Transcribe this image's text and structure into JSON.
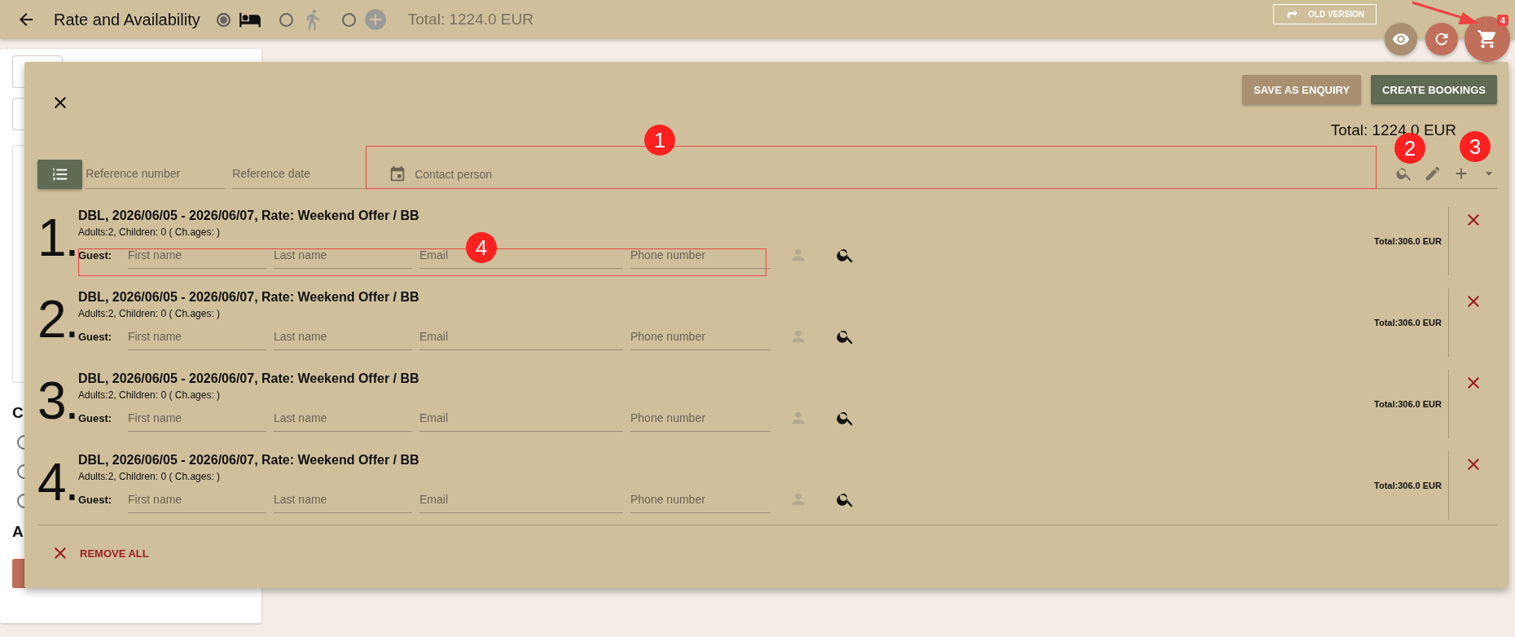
{
  "app_bar": {
    "title": "Rate and Availability",
    "modes": [
      {
        "kind": "room",
        "selected": true
      },
      {
        "kind": "activity",
        "selected": false
      },
      {
        "kind": "extra",
        "selected": false
      }
    ],
    "total": "Total: 1224.0 EUR",
    "old_version_button": "OLD VERSION"
  },
  "cart_badge": "4",
  "background_panel": {
    "headings": [
      "C",
      "A"
    ],
    "radios": [
      {
        "selected": false
      },
      {
        "selected": false
      },
      {
        "selected": false
      }
    ]
  },
  "dialog": {
    "buttons": [
      {
        "label": "SAVE AS ENQUIRY",
        "kind": "secondary"
      },
      {
        "label": "CREATE BOOKINGS",
        "kind": "primary"
      }
    ],
    "total": "Total: 1224.0 EUR",
    "fields": [
      {
        "placeholder": "Reference number",
        "kind": "text"
      },
      {
        "placeholder": "Reference date",
        "kind": "text"
      },
      {
        "placeholder": "Contact person",
        "kind": "date"
      }
    ],
    "bookings": [
      {
        "number": "1.",
        "title": "DBL, 2026/06/05 - 2026/06/07, Rate: Weekend Offer / BB",
        "details": "Adults:2, Children: 0 ( Ch.ages: )",
        "guest_label": "Guest:",
        "guest_fields": [
          {
            "placeholder": "First name"
          },
          {
            "placeholder": "Last name"
          },
          {
            "placeholder": "Email"
          },
          {
            "placeholder": "Phone number"
          }
        ],
        "total": "Total:306.0 EUR"
      },
      {
        "number": "2.",
        "title": "DBL, 2026/06/05 - 2026/06/07, Rate: Weekend Offer / BB",
        "details": "Adults:2, Children: 0 ( Ch.ages: )",
        "guest_label": "Guest:",
        "guest_fields": [
          {
            "placeholder": "First name"
          },
          {
            "placeholder": "Last name"
          },
          {
            "placeholder": "Email"
          },
          {
            "placeholder": "Phone number"
          }
        ],
        "total": "Total:306.0 EUR"
      },
      {
        "number": "3.",
        "title": "DBL, 2026/06/05 - 2026/06/07, Rate: Weekend Offer / BB",
        "details": "Adults:2, Children: 0 ( Ch.ages: )",
        "guest_label": "Guest:",
        "guest_fields": [
          {
            "placeholder": "First name"
          },
          {
            "placeholder": "Last name"
          },
          {
            "placeholder": "Email"
          },
          {
            "placeholder": "Phone number"
          }
        ],
        "total": "Total:306.0 EUR"
      },
      {
        "number": "4.",
        "title": "DBL, 2026/06/05 - 2026/06/07, Rate: Weekend Offer / BB",
        "details": "Adults:2, Children: 0 ( Ch.ages: )",
        "guest_label": "Guest:",
        "guest_fields": [
          {
            "placeholder": "First name"
          },
          {
            "placeholder": "Last name"
          },
          {
            "placeholder": "Email"
          },
          {
            "placeholder": "Phone number"
          }
        ],
        "total": "Total:306.0 EUR"
      }
    ],
    "remove_all": "REMOVE ALL"
  },
  "annotations": [
    {
      "label": "1",
      "kind": "boxed"
    },
    {
      "label": "2",
      "kind": "marker"
    },
    {
      "label": "3",
      "kind": "marker"
    },
    {
      "label": "4",
      "kind": "boxed"
    }
  ]
}
